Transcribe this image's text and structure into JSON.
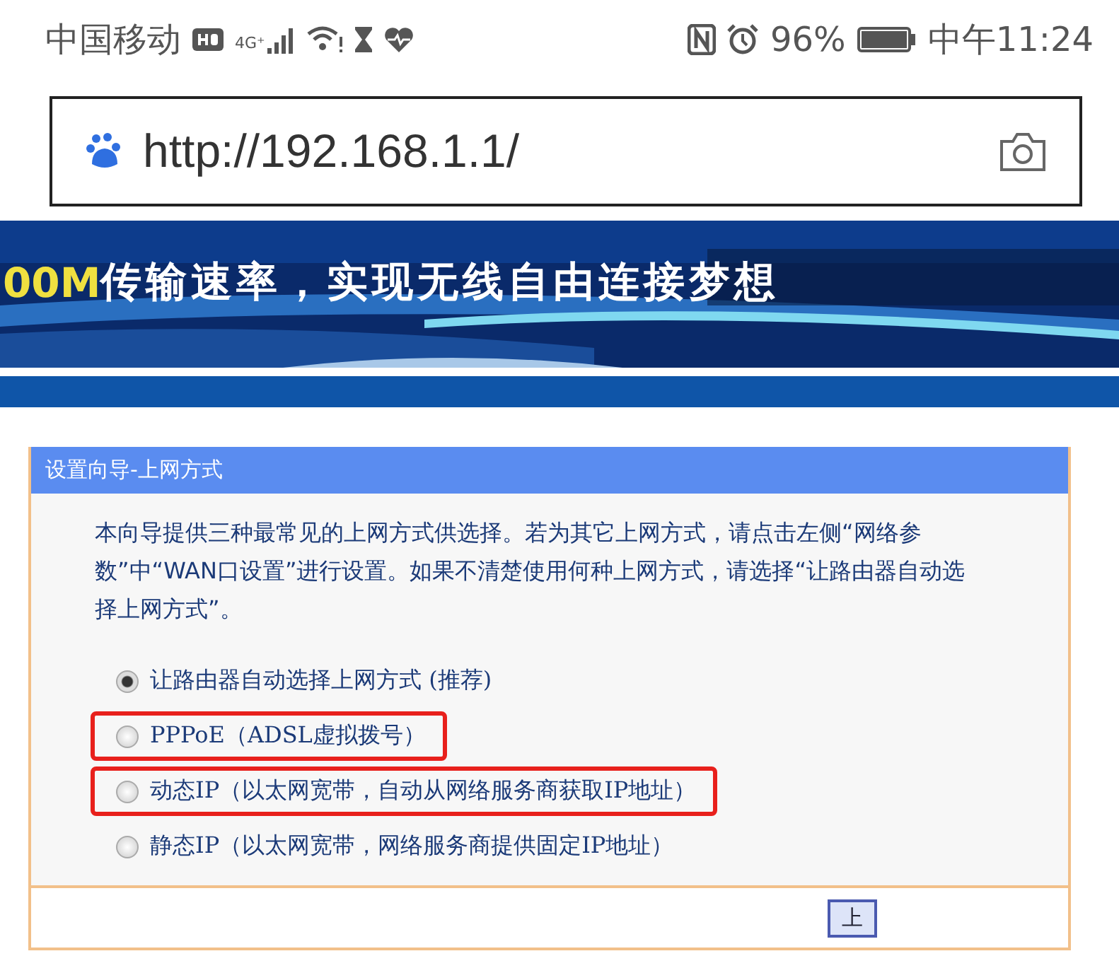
{
  "status_bar": {
    "carrier": "中国移动",
    "network": "4G⁺",
    "battery": "96%",
    "time": "中午11:24"
  },
  "address_bar": {
    "url": "http://192.168.1.1/"
  },
  "banner": {
    "text_highlight": "00M",
    "text": "传输速率，实现无线自由连接梦想"
  },
  "panel": {
    "title": "设置向导-上网方式",
    "description": "本向导提供三种最常见的上网方式供选择。若为其它上网方式，请点击左侧“网络参数”中“WAN口设置”进行设置。如果不清楚使用何种上网方式，请选择“让路由器自动选择上网方式”。",
    "options": [
      {
        "label": "让路由器自动选择上网方式 (推荐)",
        "selected": true,
        "highlighted": false
      },
      {
        "label": "PPPoE（ADSL虚拟拨号）",
        "selected": false,
        "highlighted": true
      },
      {
        "label": "动态IP（以太网宽带，自动从网络服务商获取IP地址）",
        "selected": false,
        "highlighted": true
      },
      {
        "label": "静态IP（以太网宽带，网络服务商提供固定IP地址）",
        "selected": false,
        "highlighted": false
      }
    ],
    "buttons": [
      "上"
    ]
  }
}
